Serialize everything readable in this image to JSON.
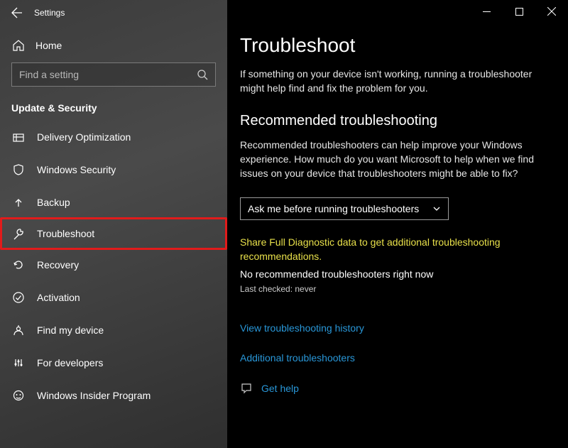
{
  "window": {
    "title": "Settings"
  },
  "sidebar": {
    "home_label": "Home",
    "search_placeholder": "Find a setting",
    "category": "Update & Security",
    "items": [
      {
        "label": "Delivery Optimization"
      },
      {
        "label": "Windows Security"
      },
      {
        "label": "Backup"
      },
      {
        "label": "Troubleshoot"
      },
      {
        "label": "Recovery"
      },
      {
        "label": "Activation"
      },
      {
        "label": "Find my device"
      },
      {
        "label": "For developers"
      },
      {
        "label": "Windows Insider Program"
      }
    ]
  },
  "main": {
    "heading": "Troubleshoot",
    "intro": "If something on your device isn't working, running a troubleshooter might help find and fix the problem for you.",
    "rec_heading": "Recommended troubleshooting",
    "rec_body": "Recommended troubleshooters can help improve your Windows experience. How much do you want Microsoft to help when we find issues on your device that troubleshooters might be able to fix?",
    "select_value": "Ask me before running troubleshooters",
    "notice": "Share Full Diagnostic data to get additional troubleshooting recommendations.",
    "status": "No recommended troubleshooters right now",
    "last_checked": "Last checked: never",
    "history_link": "View troubleshooting history",
    "additional_link": "Additional troubleshooters",
    "get_help_link": "Get help"
  }
}
